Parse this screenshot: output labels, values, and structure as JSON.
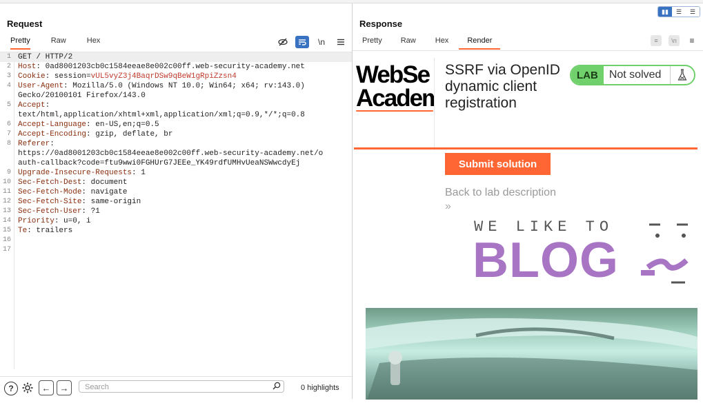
{
  "request": {
    "title": "Request",
    "tabs": [
      {
        "label": "Pretty",
        "active": true
      },
      {
        "label": "Raw",
        "active": false
      },
      {
        "label": "Hex",
        "active": false
      }
    ],
    "tools": [
      "eye-off-icon",
      "wrap-lines-icon",
      "newline-icon",
      "menu-icon"
    ],
    "tool_newline_label": "\\n",
    "lines": [
      {
        "n": "1",
        "name": "",
        "value": "GET / HTTP/2"
      },
      {
        "n": "2",
        "name": "Host",
        "value": ": 0ad8001203cb0c1584eeae8e002c00ff.web-security-academy.net"
      },
      {
        "n": "3",
        "name": "Cookie",
        "value": ": session=",
        "cookie": "vUL5vyZ3j4BaqrDSw9qBeW1gRpiZzsn4"
      },
      {
        "n": "4",
        "name": "User-Agent",
        "value": ": Mozilla/5.0 (Windows NT 10.0; Win64; x64; rv:143.0)"
      },
      {
        "n": "",
        "name": "",
        "value": "Gecko/20100101 Firefox/143.0"
      },
      {
        "n": "5",
        "name": "Accept",
        "value": ":"
      },
      {
        "n": "",
        "name": "",
        "value": "text/html,application/xhtml+xml,application/xml;q=0.9,*/*;q=0.8"
      },
      {
        "n": "6",
        "name": "Accept-Language",
        "value": ": en-US,en;q=0.5"
      },
      {
        "n": "7",
        "name": "Accept-Encoding",
        "value": ": gzip, deflate, br"
      },
      {
        "n": "8",
        "name": "Referer",
        "value": ":"
      },
      {
        "n": "",
        "name": "",
        "value": "https://0ad8001203cb0c1584eeae8e002c00ff.web-security-academy.net/o"
      },
      {
        "n": "",
        "name": "",
        "value": "auth-callback?code=ftu9wwi0FGHUrG7JEEe_YK49rdfUMHvUeaNSWwcdyEj"
      },
      {
        "n": "9",
        "name": "Upgrade-Insecure-Requests",
        "value": ": 1"
      },
      {
        "n": "10",
        "name": "Sec-Fetch-Dest",
        "value": ": document"
      },
      {
        "n": "11",
        "name": "Sec-Fetch-Mode",
        "value": ": navigate"
      },
      {
        "n": "12",
        "name": "Sec-Fetch-Site",
        "value": ": same-origin"
      },
      {
        "n": "13",
        "name": "Sec-Fetch-User",
        "value": ": ?1"
      },
      {
        "n": "14",
        "name": "Priority",
        "value": ": u=0, i"
      },
      {
        "n": "15",
        "name": "Te",
        "value": ": trailers"
      },
      {
        "n": "16",
        "name": "",
        "value": ""
      },
      {
        "n": "17",
        "name": "",
        "value": ""
      }
    ],
    "search_placeholder": "Search",
    "highlights": "0 highlights"
  },
  "response": {
    "title": "Response",
    "tabs": [
      {
        "label": "Pretty",
        "active": false
      },
      {
        "label": "Raw",
        "active": false
      },
      {
        "label": "Hex",
        "active": false
      },
      {
        "label": "Render",
        "active": true
      }
    ],
    "render": {
      "logo_line1": "WebSe",
      "logo_line2": "Academ",
      "lab_title": "SSRF via OpenID dynamic client registration",
      "lab_badge": "LAB",
      "lab_status": "Not solved",
      "submit_label": "Submit solution",
      "back_link": "Back to lab description",
      "back_chevron": "»",
      "blog_tagline": "WE LIKE TO",
      "blog_word": "BLOG"
    }
  },
  "colors": {
    "accent": "#ff6633",
    "lab_green": "#70d06b",
    "blog_purple": "#a874c4",
    "toggle_blue": "#3a72c2"
  }
}
